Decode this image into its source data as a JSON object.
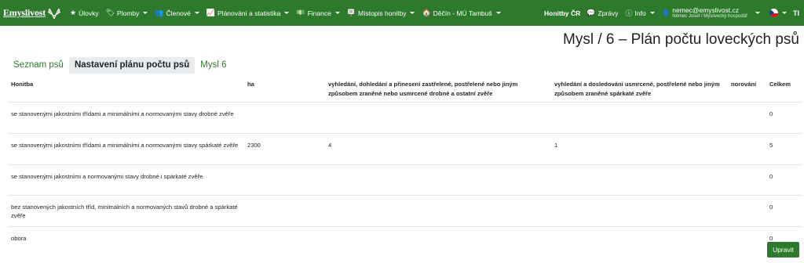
{
  "navbar": {
    "brand": "Emyslivost",
    "items": [
      {
        "icon": "star-icon",
        "glyph": "★",
        "label": "Úlovky",
        "caret": false
      },
      {
        "icon": "tag-icon",
        "glyph": "🏷",
        "label": "Plomby",
        "caret": true
      },
      {
        "icon": "users-icon",
        "glyph": "👥",
        "label": "Členové",
        "caret": true
      },
      {
        "icon": "chart-icon",
        "glyph": "📈",
        "label": "Plánování a statistika",
        "caret": true
      },
      {
        "icon": "money-icon",
        "glyph": "💵",
        "label": "Finance",
        "caret": true
      },
      {
        "icon": "signpost-icon",
        "glyph": "🪧",
        "label": "Místopis honitby",
        "caret": true
      },
      {
        "icon": "home-icon",
        "glyph": "🏠",
        "label": "Děčín - MÚ Tambuš",
        "caret": true
      }
    ],
    "right": {
      "honitby": "Honitby ČR",
      "zpravy": "Zprávy",
      "info": "Info",
      "user_email": "nemec@emyslivost.cz",
      "user_sub": "Němec Josef / Myslivecký hospodář",
      "tt": "TI"
    }
  },
  "page_title": "Mysl / 6 – Plán počtu loveckých psů",
  "tabs": [
    "Seznam psů",
    "Nastavení plánu počtu psů",
    "Mysl 6"
  ],
  "table": {
    "headers": [
      "Honitba",
      "ha",
      "vyhledání, dohledání a přinesení zastřelené, postřelené nebo jiným způsobem zraněné nebo usmrcené drobné a ostatní zvěře",
      "vyhledání a dosledování usmrcené, postřelené nebo jiným způsobem zraněné spárkaté zvěře",
      "norování",
      "Celkem"
    ],
    "rows": [
      [
        "se stanovenými jakostními třídami a minimálními a normovanými stavy drobné zvěře",
        "",
        "",
        "",
        "",
        "0"
      ],
      [
        "se stanovenými jakostními třídami a minimálními a normovanými stavy spárkaté zvěře",
        "2300",
        "4",
        "1",
        "",
        "5"
      ],
      [
        "se stanovenými jakostními a normovanými stavy drobné i spárkaté zvěře",
        "",
        "",
        "",
        "",
        "0"
      ],
      [
        "bez stanovených jakostních tříd, minimálních a normovaných stavů drobné a spárkaté zvěře",
        "",
        "",
        "",
        "",
        "0"
      ],
      [
        "obora",
        "",
        "",
        "",
        "",
        "0"
      ]
    ]
  },
  "button": "Upravit"
}
